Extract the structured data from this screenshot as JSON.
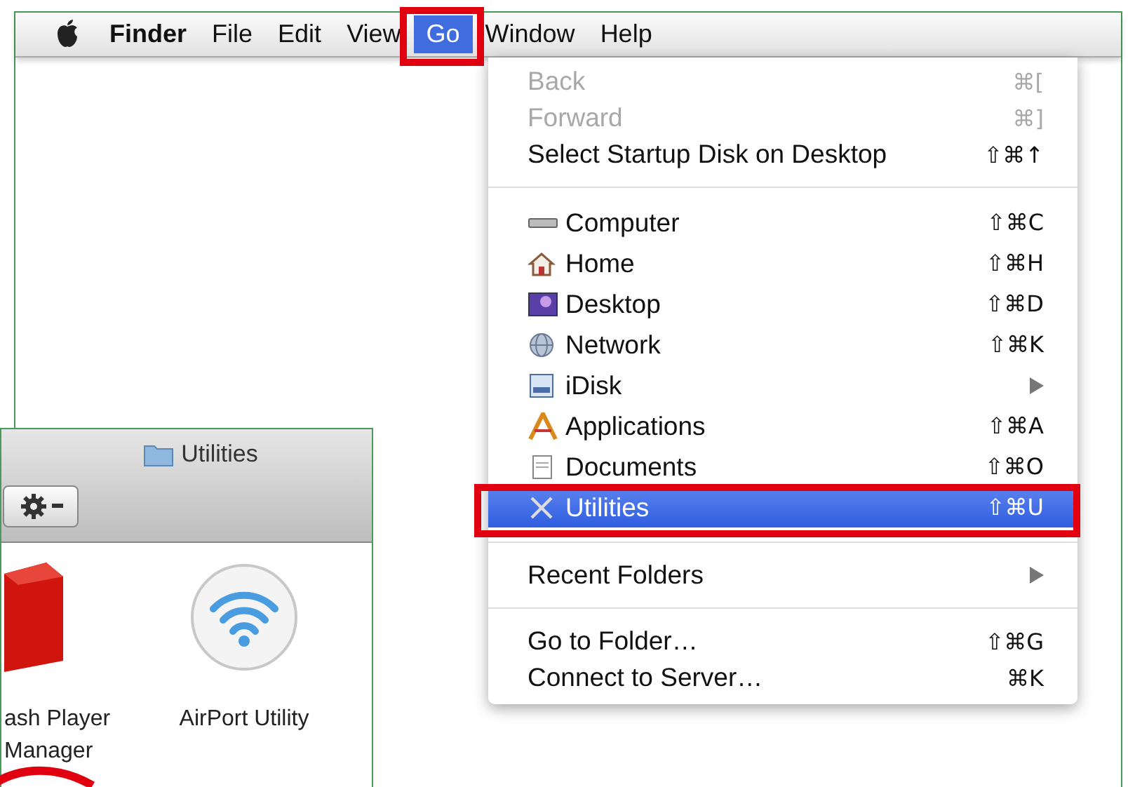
{
  "menu_bar": {
    "items": [
      {
        "label": "Finder",
        "kind": "app",
        "selected": false,
        "highlighted": false
      },
      {
        "label": "File",
        "kind": "menu",
        "selected": false,
        "highlighted": false
      },
      {
        "label": "Edit",
        "kind": "menu",
        "selected": false,
        "highlighted": false
      },
      {
        "label": "View",
        "kind": "menu",
        "selected": false,
        "highlighted": false
      },
      {
        "label": "Go",
        "kind": "menu",
        "selected": true,
        "highlighted": true
      },
      {
        "label": "Window",
        "kind": "menu",
        "selected": false,
        "highlighted": false
      },
      {
        "label": "Help",
        "kind": "menu",
        "selected": false,
        "highlighted": false
      }
    ]
  },
  "go_menu": {
    "items": [
      {
        "kind": "command",
        "label": "Back",
        "shortcut": "⌘[",
        "disabled": true,
        "selected": false,
        "highlighted": false,
        "submenu": false
      },
      {
        "kind": "command",
        "label": "Forward",
        "shortcut": "⌘]",
        "disabled": true,
        "selected": false,
        "highlighted": false,
        "submenu": false
      },
      {
        "kind": "command",
        "label": "Select Startup Disk on Desktop",
        "shortcut": "⇧⌘↑",
        "disabled": false,
        "selected": false,
        "highlighted": false,
        "submenu": false
      },
      {
        "kind": "separator"
      },
      {
        "kind": "place",
        "label": "Computer",
        "shortcut": "⇧⌘C",
        "disabled": false,
        "selected": false,
        "highlighted": false,
        "submenu": false
      },
      {
        "kind": "place",
        "label": "Home",
        "shortcut": "⇧⌘H",
        "disabled": false,
        "selected": false,
        "highlighted": false,
        "submenu": false
      },
      {
        "kind": "place",
        "label": "Desktop",
        "shortcut": "⇧⌘D",
        "disabled": false,
        "selected": false,
        "highlighted": false,
        "submenu": false
      },
      {
        "kind": "place",
        "label": "Network",
        "shortcut": "⇧⌘K",
        "disabled": false,
        "selected": false,
        "highlighted": false,
        "submenu": false
      },
      {
        "kind": "place",
        "label": "iDisk",
        "disabled": false,
        "selected": false,
        "highlighted": false,
        "submenu": true
      },
      {
        "kind": "place",
        "label": "Applications",
        "shortcut": "⇧⌘A",
        "disabled": false,
        "selected": false,
        "highlighted": false,
        "submenu": false
      },
      {
        "kind": "place",
        "label": "Documents",
        "shortcut": "⇧⌘O",
        "disabled": false,
        "selected": false,
        "highlighted": false,
        "submenu": false
      },
      {
        "kind": "place",
        "label": "Utilities",
        "shortcut": "⇧⌘U",
        "disabled": false,
        "selected": true,
        "highlighted": true,
        "submenu": false
      },
      {
        "kind": "separator"
      },
      {
        "kind": "command",
        "label": "Recent Folders",
        "disabled": false,
        "selected": false,
        "highlighted": false,
        "submenu": true
      },
      {
        "kind": "separator"
      },
      {
        "kind": "command",
        "label": "Go to Folder…",
        "shortcut": "⇧⌘G",
        "disabled": false,
        "selected": false,
        "highlighted": false,
        "submenu": false
      },
      {
        "kind": "command",
        "label": "Connect to Server…",
        "shortcut": "⌘K",
        "disabled": false,
        "selected": false,
        "highlighted": false,
        "submenu": false
      }
    ]
  },
  "utilities_window": {
    "title": "Utilities",
    "items": [
      {
        "label_lines": [
          "ash Player",
          "Manager"
        ]
      },
      {
        "label_lines": [
          "AirPort Utility"
        ]
      }
    ]
  }
}
